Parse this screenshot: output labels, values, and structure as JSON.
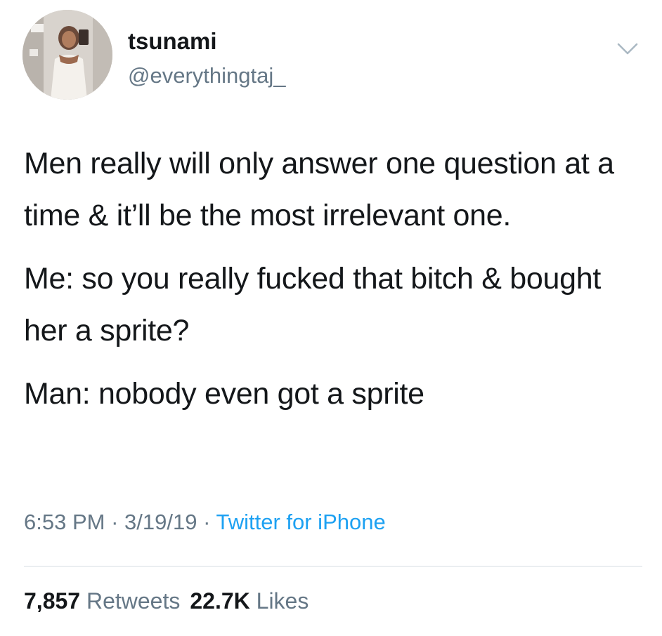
{
  "user": {
    "display_name": "tsunami",
    "handle": "@everythingtaj_"
  },
  "tweet": {
    "paragraphs": [
      "Men really will only answer one question at a time & it’ll be the most irrelevant one.",
      "Me: so you really fucked that bitch & bought her a sprite?",
      "Man: nobody even got a sprite"
    ],
    "time": "6:53 PM",
    "separator": "·",
    "date": "3/19/19",
    "source": "Twitter for iPhone"
  },
  "stats": {
    "retweets_count": "7,857",
    "retweets_label": "Retweets",
    "likes_count": "22.7K",
    "likes_label": "Likes"
  },
  "icons": {
    "menu": "chevron-down-icon",
    "avatar": "profile-photo"
  },
  "colors": {
    "text": "#14171a",
    "secondary": "#657786",
    "link": "#1da1f2",
    "divider": "#d6dde3"
  }
}
